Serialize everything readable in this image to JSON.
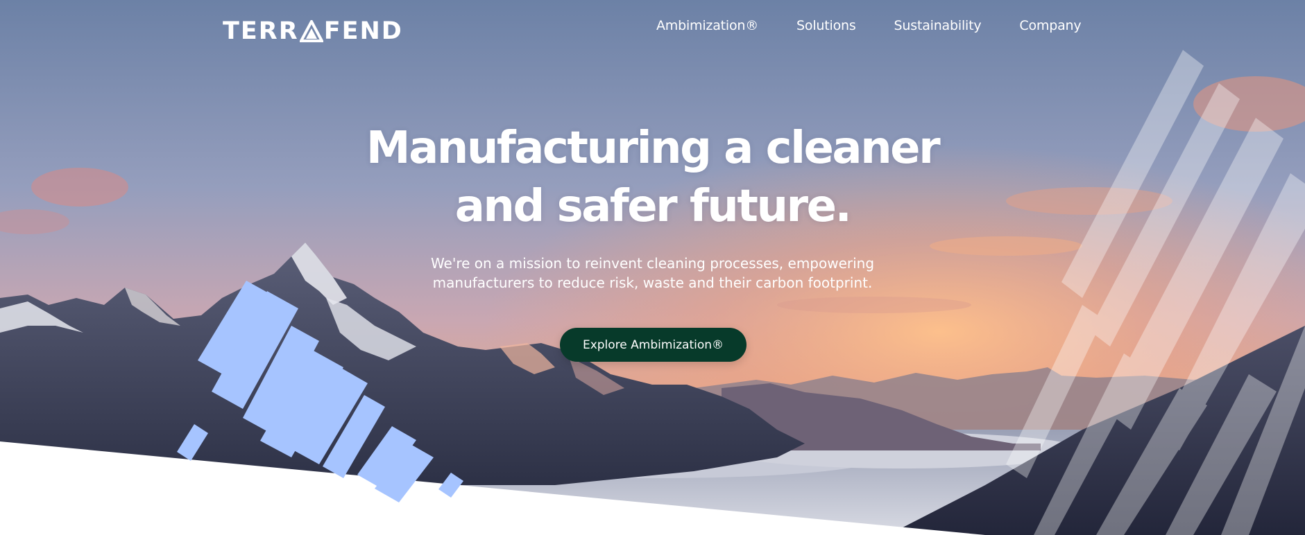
{
  "brand": {
    "name_before": "TERR",
    "name_after": "FEND",
    "logo_mark": "triangle-a-mark"
  },
  "nav": {
    "items": [
      {
        "label": "Ambimization®"
      },
      {
        "label": "Solutions"
      },
      {
        "label": "Sustainability"
      },
      {
        "label": "Company"
      }
    ]
  },
  "hero": {
    "headline_line1": "Manufacturing a cleaner",
    "headline_line2": "and safer future.",
    "sub_line1": "We're on a mission to reinvent cleaning processes, empowering",
    "sub_line2": "manufacturers to reduce risk, waste and their carbon footprint.",
    "cta_label": "Explore Ambimization®"
  },
  "colors": {
    "cta_bg": "#073a2a",
    "accent_stripes": "#a6c4ff",
    "text": "#ffffff"
  },
  "background_image": "mountain-sunrise-landscape"
}
